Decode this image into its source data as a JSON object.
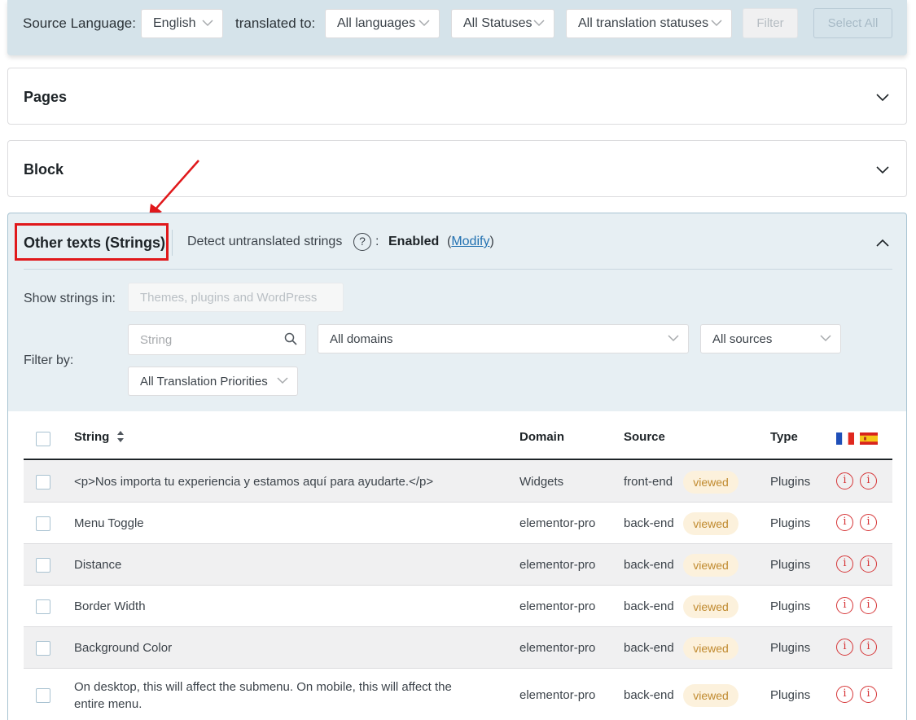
{
  "topbar": {
    "source_label": "Source Language:",
    "source_value": "English",
    "translated_label": "translated to:",
    "languages_value": "All languages",
    "statuses_value": "All Statuses",
    "translation_statuses_value": "All translation statuses",
    "filter_button": "Filter",
    "select_all_button": "Select All"
  },
  "sections": {
    "pages": "Pages",
    "block": "Block"
  },
  "strings_panel": {
    "title": "Other texts (Strings)",
    "detect_label": "Detect untranslated strings",
    "help_icon": "?",
    "colon": ":",
    "enabled": "Enabled",
    "modify_open": "(",
    "modify_link": "Modify",
    "modify_close": ")",
    "show_strings_label": "Show strings in:",
    "show_strings_value": "Themes, plugins and WordPress",
    "filter_by_label": "Filter by:",
    "string_placeholder": "String",
    "domains_value": "All domains",
    "sources_value": "All sources",
    "priorities_value": "All Translation Priorities"
  },
  "table": {
    "headers": {
      "string": "String",
      "domain": "Domain",
      "source": "Source",
      "type": "Type"
    },
    "flags": [
      "fr",
      "es"
    ],
    "rows": [
      {
        "string": "<p>Nos importa tu experiencia y estamos aquí para ayudarte.</p>",
        "domain": "Widgets",
        "source": "front-end",
        "status": "viewed",
        "type": "Plugins"
      },
      {
        "string": "Menu Toggle",
        "domain": "elementor-pro",
        "source": "back-end",
        "status": "viewed",
        "type": "Plugins"
      },
      {
        "string": "Distance",
        "domain": "elementor-pro",
        "source": "back-end",
        "status": "viewed",
        "type": "Plugins"
      },
      {
        "string": "Border Width",
        "domain": "elementor-pro",
        "source": "back-end",
        "status": "viewed",
        "type": "Plugins"
      },
      {
        "string": "Background Color",
        "domain": "elementor-pro",
        "source": "back-end",
        "status": "viewed",
        "type": "Plugins"
      },
      {
        "string": "On desktop, this will affect the submenu. On mobile, this will affect the entire menu.",
        "domain": "elementor-pro",
        "source": "back-end",
        "status": "viewed",
        "type": "Plugins"
      }
    ]
  },
  "colors": {
    "accent_link": "#2271b1",
    "highlight_red": "#e0181b",
    "missing_translation": "#d63638",
    "viewed_badge_bg": "#fcf1dc",
    "viewed_badge_text": "#c08a2f",
    "panel_bg": "#e7eff3"
  },
  "icons": {
    "dropdown": "chevron-down-icon",
    "collapse": "chevron-up-icon",
    "search": "search-icon",
    "sort": "sort-icon",
    "missing": "info-icon"
  }
}
